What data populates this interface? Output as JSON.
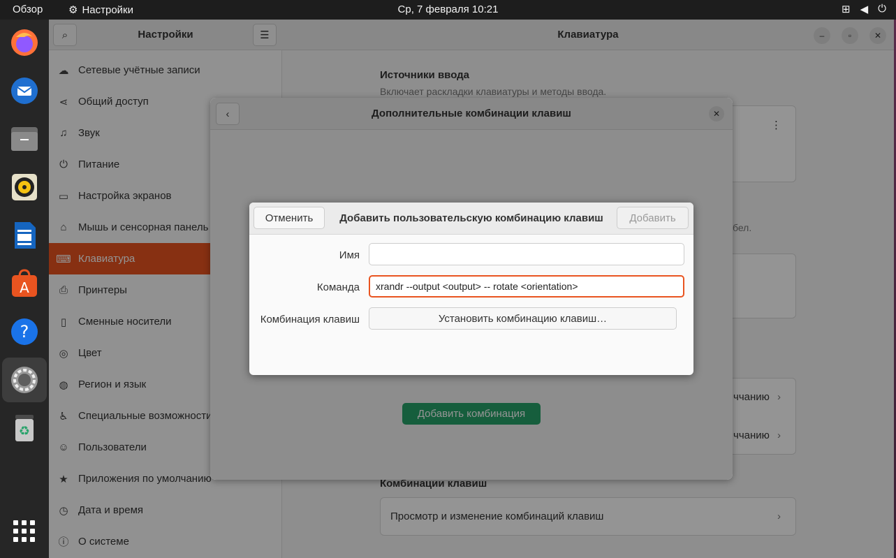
{
  "topbar": {
    "overview": "Обзор",
    "app_name": "Настройки",
    "clock": "Ср, 7 февраля  10:21"
  },
  "dock": {
    "items": [
      "firefox-icon",
      "thunderbird-icon",
      "files-icon",
      "rhythmbox-icon",
      "writer-icon",
      "software-icon",
      "help-icon",
      "settings-icon",
      "trash-icon",
      "apps-grid-icon"
    ]
  },
  "sidebar": {
    "title": "Настройки",
    "items": [
      {
        "label": "Сетевые учётные записи",
        "icon": "☁"
      },
      {
        "label": "Общий доступ",
        "icon": "⋖"
      },
      {
        "label": "Звук",
        "icon": "♫"
      },
      {
        "label": "Питание",
        "icon": "⏻"
      },
      {
        "label": "Настройка экранов",
        "icon": "▭"
      },
      {
        "label": "Мышь и сенсорная панель",
        "icon": "⌂"
      },
      {
        "label": "Клавиатура",
        "icon": "⌨"
      },
      {
        "label": "Принтеры",
        "icon": "⎙"
      },
      {
        "label": "Сменные носители",
        "icon": "▯"
      },
      {
        "label": "Цвет",
        "icon": "◎"
      },
      {
        "label": "Регион и язык",
        "icon": "◍"
      },
      {
        "label": "Специальные возможности",
        "icon": "♿"
      },
      {
        "label": "Пользователи",
        "icon": "☺"
      },
      {
        "label": "Приложения по умолчанию",
        "icon": "★"
      },
      {
        "label": "Дата и время",
        "icon": "◷"
      },
      {
        "label": "О системе",
        "icon": "ⓘ"
      }
    ]
  },
  "main": {
    "title": "Клавиатура",
    "input_sources_title": "Источники ввода",
    "input_sources_desc": "Включает раскладки клавиатуры и методы ввода.",
    "partial_desc": "бел.",
    "partial_row_1": "ччанию",
    "partial_row_2": "ччанию",
    "shortcuts_title": "Комбинации клавиш",
    "shortcuts_row": "Просмотр и изменение комбинаций клавиш"
  },
  "shortcuts_dialog": {
    "title": "Дополнительные комбинации клавиш",
    "add_button": "Добавить комбинация"
  },
  "modal": {
    "title": "Добавить пользовательскую комбинацию клавиш",
    "cancel": "Отменить",
    "add": "Добавить",
    "name_label": "Имя",
    "name_value": "",
    "command_label": "Команда",
    "command_value": "xrandr --output <output> -- rotate <orientation>",
    "shortcut_label": "Комбинация клавиш",
    "shortcut_button": "Установить комбинацию клавиш…"
  },
  "colors": {
    "accent": "#e95420",
    "green": "#26a269"
  }
}
